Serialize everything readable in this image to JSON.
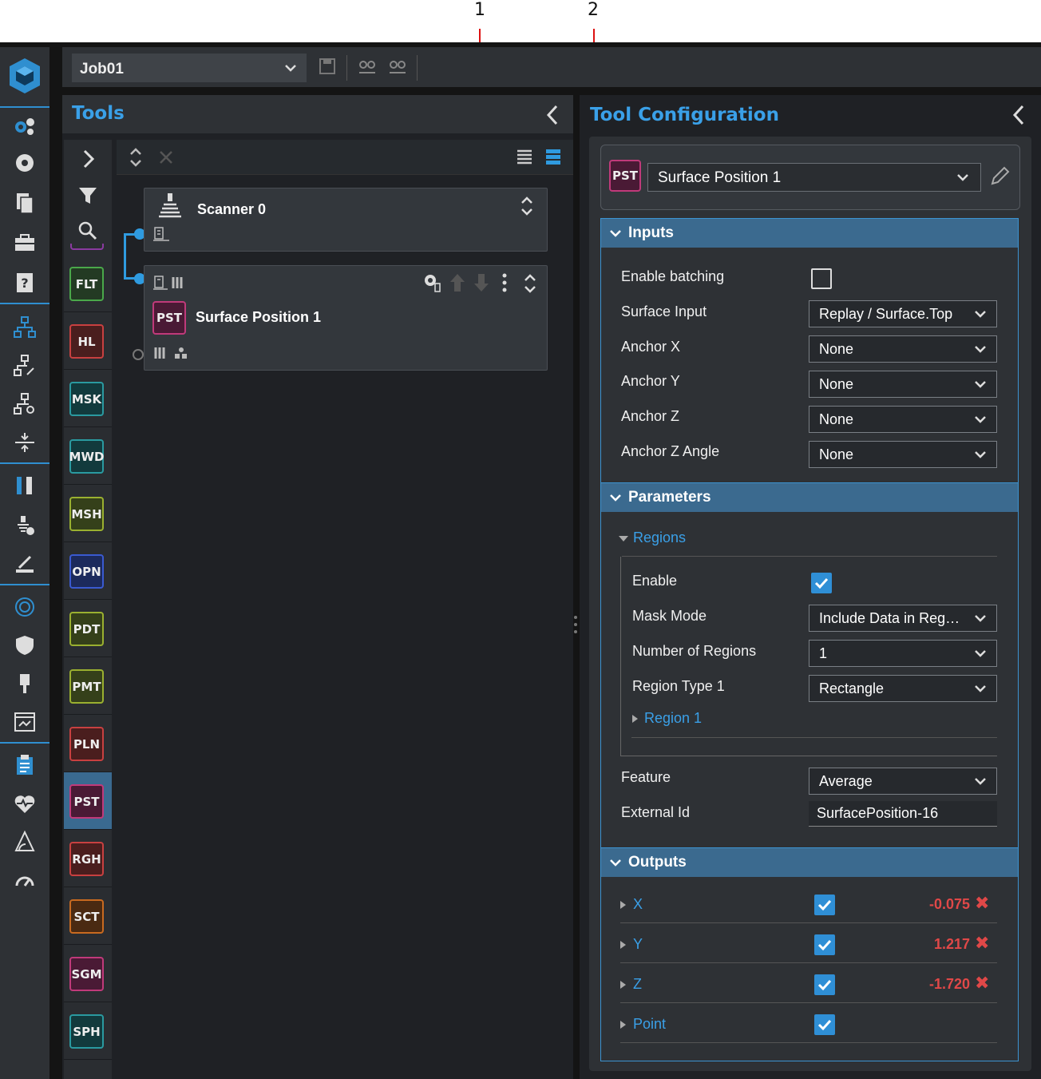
{
  "callouts": [
    "1",
    "2"
  ],
  "topbar": {
    "job": "Job01"
  },
  "tools_panel": {
    "title": "Tools",
    "tool_list": [
      {
        "code": "FLT",
        "color": "#4aa84a"
      },
      {
        "code": "HL",
        "color": "#c84040"
      },
      {
        "code": "MSK",
        "color": "#2a9aa0"
      },
      {
        "code": "MWD",
        "color": "#2a9aa0"
      },
      {
        "code": "MSH",
        "color": "#9ab030"
      },
      {
        "code": "OPN",
        "color": "#3a5ad0"
      },
      {
        "code": "PDT",
        "color": "#9ab030"
      },
      {
        "code": "PMT",
        "color": "#9ab030"
      },
      {
        "code": "PLN",
        "color": "#c84040"
      },
      {
        "code": "PST",
        "color": "#c03a7a"
      },
      {
        "code": "RGH",
        "color": "#c84040"
      },
      {
        "code": "SCT",
        "color": "#c86a20"
      },
      {
        "code": "SGM",
        "color": "#c03a7a"
      },
      {
        "code": "SPH",
        "color": "#2a9aa0"
      }
    ],
    "nodes": {
      "scanner": {
        "title": "Scanner 0"
      },
      "surface": {
        "badge": "PST",
        "title": "Surface Position 1"
      }
    }
  },
  "config_panel": {
    "title": "Tool Configuration",
    "tool_badge": "PST",
    "tool_name": "Surface Position 1",
    "inputs": {
      "header": "Inputs",
      "enable_batching_label": "Enable batching",
      "surface_input_label": "Surface Input",
      "surface_input_value": "Replay / Surface.Top",
      "anchor_x_label": "Anchor X",
      "anchor_x_value": "None",
      "anchor_y_label": "Anchor Y",
      "anchor_y_value": "None",
      "anchor_z_label": "Anchor Z",
      "anchor_z_value": "None",
      "anchor_z_angle_label": "Anchor Z Angle",
      "anchor_z_angle_value": "None"
    },
    "parameters": {
      "header": "Parameters",
      "regions_label": "Regions",
      "enable_label": "Enable",
      "mask_mode_label": "Mask Mode",
      "mask_mode_value": "Include Data in Reg…",
      "num_regions_label": "Number of Regions",
      "num_regions_value": "1",
      "region_type_label": "Region Type 1",
      "region_type_value": "Rectangle",
      "region1_label": "Region 1",
      "feature_label": "Feature",
      "feature_value": "Average",
      "external_id_label": "External Id",
      "external_id_value": "SurfacePosition-16"
    },
    "outputs": {
      "header": "Outputs",
      "items": [
        {
          "name": "X",
          "value": "-0.075"
        },
        {
          "name": "Y",
          "value": "1.217"
        },
        {
          "name": "Z",
          "value": "-1.720"
        },
        {
          "name": "Point",
          "value": ""
        }
      ]
    }
  }
}
